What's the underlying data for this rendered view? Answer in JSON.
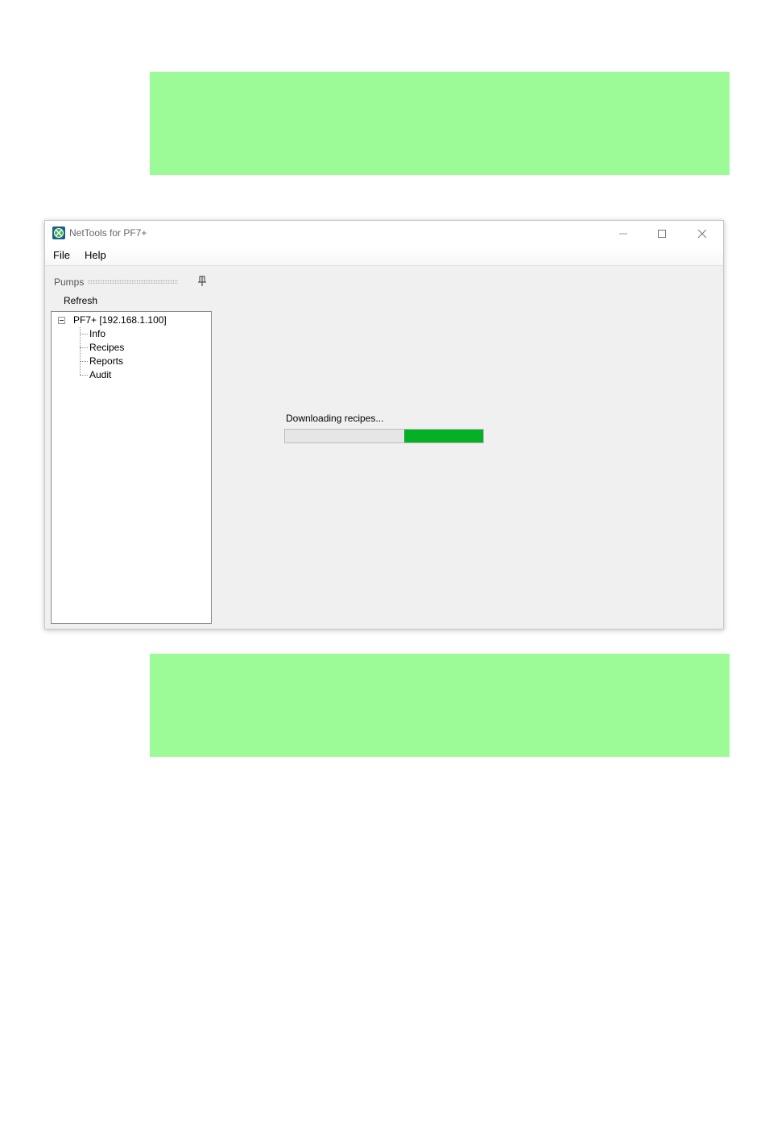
{
  "window": {
    "title": "NetTools for PF7+"
  },
  "menu": {
    "file": "File",
    "help": "Help"
  },
  "pane": {
    "title": "Pumps",
    "refresh": "Refresh",
    "tree": {
      "root": "PF7+ [192.168.1.100]",
      "children": [
        "Info",
        "Recipes",
        "Reports",
        "Audit"
      ]
    }
  },
  "progress": {
    "message": "Downloading recipes...",
    "level_fraction": 0.4,
    "fill_color": "#06b025"
  },
  "colors": {
    "highlight_block": "#9cfb97"
  },
  "icons": {
    "app": "app-icon",
    "minimize": "minimize-icon",
    "maximize": "maximize-icon",
    "close": "close-icon",
    "pin": "pin-icon",
    "collapse": "collapse-icon"
  }
}
